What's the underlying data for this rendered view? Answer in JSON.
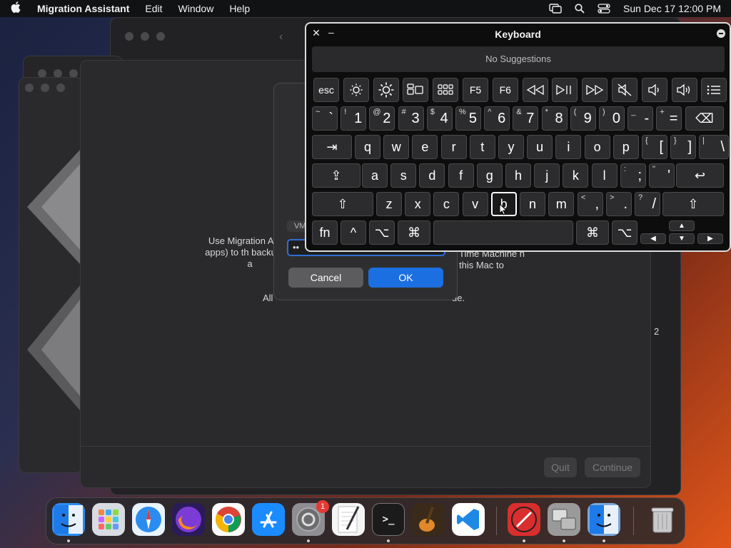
{
  "menubar": {
    "app_name": "Migration Assistant",
    "items": [
      "Edit",
      "Window",
      "Help"
    ],
    "datetime": "Sun Dec 17  12:00 PM"
  },
  "main_window": {
    "text_left": "Use Migration A and apps) to th backup, or a",
    "text_right": "Time Machine n this Mac to",
    "text_bottom_left": "All",
    "text_bottom_right": "ue.",
    "side_number": "2",
    "quit_label": "Quit",
    "continue_label": "Continue"
  },
  "sheet": {
    "vm_label": "VM",
    "password_value": "••",
    "cancel_label": "Cancel",
    "ok_label": "OK"
  },
  "keyboard_viewer": {
    "title": "Keyboard",
    "suggestions": "No Suggestions",
    "highlighted_key": "h",
    "fn_row": [
      {
        "label": "esc",
        "icon": null
      },
      {
        "label": "",
        "icon": "brightness-down-icon"
      },
      {
        "label": "",
        "icon": "brightness-up-icon"
      },
      {
        "label": "",
        "icon": "mission-control-icon"
      },
      {
        "label": "",
        "icon": "launchpad-icon"
      },
      {
        "label": "F5",
        "icon": null
      },
      {
        "label": "F6",
        "icon": null
      },
      {
        "label": "",
        "icon": "rewind-icon"
      },
      {
        "label": "",
        "icon": "play-pause-icon"
      },
      {
        "label": "",
        "icon": "fast-forward-icon"
      },
      {
        "label": "",
        "icon": "mute-icon"
      },
      {
        "label": "",
        "icon": "volume-down-icon"
      },
      {
        "label": "",
        "icon": "volume-up-icon"
      },
      {
        "label": "",
        "icon": "list-icon"
      }
    ],
    "number_row": [
      {
        "top": "~",
        "main": "`"
      },
      {
        "top": "!",
        "main": "1"
      },
      {
        "top": "@",
        "main": "2"
      },
      {
        "top": "#",
        "main": "3"
      },
      {
        "top": "$",
        "main": "4"
      },
      {
        "top": "%",
        "main": "5"
      },
      {
        "top": "^",
        "main": "6"
      },
      {
        "top": "&",
        "main": "7"
      },
      {
        "top": "*",
        "main": "8"
      },
      {
        "top": "(",
        "main": "9"
      },
      {
        "top": ")",
        "main": "0"
      },
      {
        "top": "_",
        "main": "-"
      },
      {
        "top": "+",
        "main": "="
      }
    ],
    "row_q": [
      "q",
      "w",
      "e",
      "r",
      "t",
      "y",
      "u",
      "i",
      "o",
      "p"
    ],
    "row_q_extra": [
      {
        "top": "{",
        "main": "["
      },
      {
        "top": "}",
        "main": "]"
      },
      {
        "top": "|",
        "main": "\\"
      }
    ],
    "row_a": [
      "a",
      "s",
      "d",
      "f",
      "g",
      "h",
      "j",
      "k",
      "l"
    ],
    "row_a_extra": [
      {
        "top": ":",
        "main": ";"
      },
      {
        "top": "\"",
        "main": "'"
      }
    ],
    "row_z": [
      "z",
      "x",
      "c",
      "v",
      "b",
      "n",
      "m"
    ],
    "row_z_extra": [
      {
        "top": "<",
        "main": ","
      },
      {
        "top": ">",
        "main": "."
      },
      {
        "top": "?",
        "main": "/"
      }
    ],
    "fn_label": "fn",
    "ctrl_label": "^",
    "opt_label": "⌥",
    "cmd_label": "⌘",
    "tab_label": "⇥",
    "caps_label": "⇪",
    "shift_label": "⇧",
    "return_label": "↩",
    "delete_label": "⌫",
    "arrow_up": "▲",
    "arrow_down": "▼",
    "arrow_left": "◀",
    "arrow_right": "▶"
  },
  "dock": {
    "items": [
      {
        "name": "finder",
        "label": "",
        "bg": "#2d8cf0"
      },
      {
        "name": "launchpad",
        "label": "",
        "bg": "#d8dbe2"
      },
      {
        "name": "safari",
        "label": "",
        "bg": "#e9f3ff"
      },
      {
        "name": "firefox",
        "label": "",
        "bg": "#2b1b5a"
      },
      {
        "name": "chrome",
        "label": "",
        "bg": "#ffffff"
      },
      {
        "name": "app-store",
        "label": "",
        "bg": "#1a8cff"
      },
      {
        "name": "system-settings",
        "label": "",
        "bg": "#8e8e93"
      },
      {
        "name": "textedit",
        "label": "",
        "bg": "#f5f5f5"
      },
      {
        "name": "terminal",
        "label": ">_",
        "bg": "#1b1b1b"
      },
      {
        "name": "garageband",
        "label": "",
        "bg": "#3a2a1a"
      },
      {
        "name": "vscode",
        "label": "",
        "bg": "#ffffff"
      },
      {
        "name": "directory-utility",
        "label": "",
        "bg": "#d92e2e"
      },
      {
        "name": "migration-assistant",
        "label": "",
        "bg": "#9a9a9a"
      },
      {
        "name": "finder-2",
        "label": "",
        "bg": "#7aa7d8"
      },
      {
        "name": "trash",
        "label": "",
        "bg": "#6d6d70"
      }
    ],
    "settings_badge": "1"
  }
}
